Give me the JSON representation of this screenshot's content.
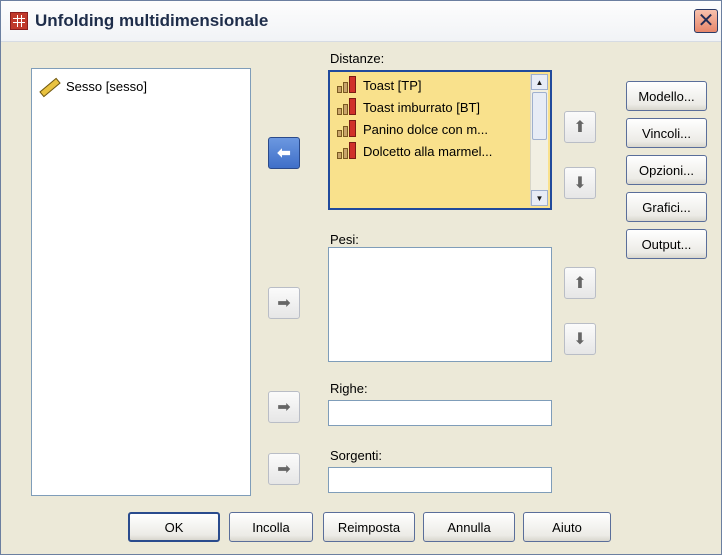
{
  "window": {
    "title": "Unfolding multidimensionale",
    "close_glyph": "✕"
  },
  "source_list": {
    "items": [
      {
        "label": "Sesso [sesso]",
        "icon": "ruler-icon"
      }
    ]
  },
  "distances": {
    "label": "Distanze:",
    "items": [
      {
        "label": "Toast [TP]",
        "icon": "ordinal-icon"
      },
      {
        "label": "Toast imburrato [BT]",
        "icon": "ordinal-icon"
      },
      {
        "label": "Panino dolce con m...",
        "icon": "ordinal-icon"
      },
      {
        "label": "Dolcetto alla marmel...",
        "icon": "ordinal-icon"
      }
    ]
  },
  "weights": {
    "label": "Pesi:"
  },
  "rows": {
    "label": "Righe:",
    "value": ""
  },
  "sources": {
    "label": "Sorgenti:",
    "value": ""
  },
  "side_buttons": {
    "model": "Modello...",
    "constraints": "Vincoli...",
    "options": "Opzioni...",
    "plots": "Grafici...",
    "output": "Output..."
  },
  "bottom_buttons": {
    "ok": "OK",
    "paste": "Incolla",
    "reset": "Reimposta",
    "cancel": "Annulla",
    "help": "Aiuto"
  },
  "arrows": {
    "left": "⬅",
    "right": "➡",
    "up": "⬆",
    "down": "⬇"
  },
  "colors": {
    "selection": "#f9e18c",
    "active_arrow": "#3f6fc8",
    "dialog_bg": "#ece9d8"
  }
}
